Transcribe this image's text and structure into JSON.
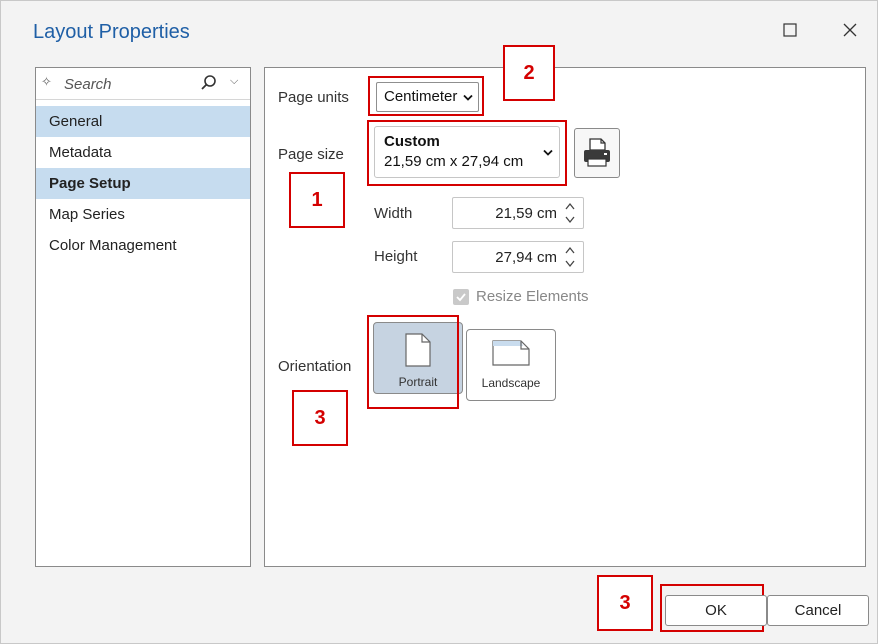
{
  "window": {
    "title": "Layout Properties",
    "maximize_icon": "maximize-icon",
    "close_icon": "close-icon"
  },
  "sidebar": {
    "search_placeholder": "Search",
    "items": [
      {
        "label": "General",
        "selected": true,
        "bold": false
      },
      {
        "label": "Metadata",
        "selected": false,
        "bold": false
      },
      {
        "label": "Page Setup",
        "selected": true,
        "bold": true
      },
      {
        "label": "Map Series",
        "selected": false,
        "bold": false
      },
      {
        "label": "Color Management",
        "selected": false,
        "bold": false
      }
    ]
  },
  "page_setup": {
    "units_label": "Page units",
    "units_value": "Centimeter",
    "size_label": "Page size",
    "size_name": "Custom",
    "size_dimensions": "21,59 cm x 27,94 cm",
    "width_label": "Width",
    "width_value": "21,59 cm",
    "height_label": "Height",
    "height_value": "27,94 cm",
    "resize_label": "Resize Elements",
    "resize_checked": true,
    "orientation_label": "Orientation",
    "portrait_label": "Portrait",
    "landscape_label": "Landscape",
    "selected_orientation": "Portrait"
  },
  "annotations": {
    "n1": "1",
    "n2": "2",
    "n3a": "3",
    "n3b": "3",
    "color": "#d40000"
  },
  "footer": {
    "ok_label": "OK",
    "cancel_label": "Cancel"
  },
  "colors": {
    "title": "#1f5fa6",
    "selection": "#c6dcef",
    "portrait_selected": "#c6d3e1"
  }
}
